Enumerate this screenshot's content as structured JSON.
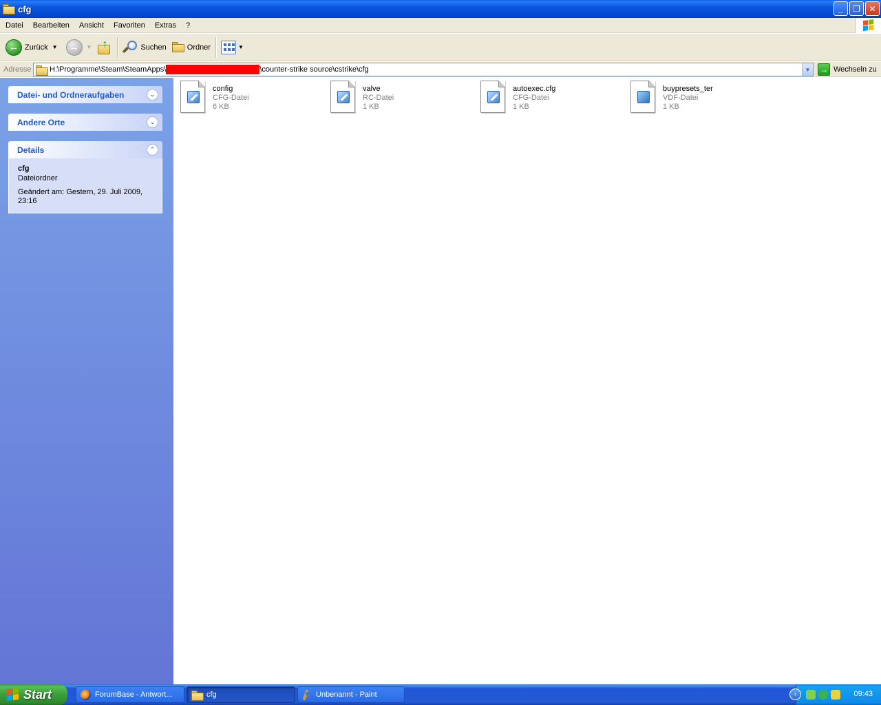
{
  "window": {
    "title": "cfg",
    "controls": {
      "minimize": "_",
      "maximize": "❐",
      "close": "✕"
    }
  },
  "menu": [
    "Datei",
    "Bearbeiten",
    "Ansicht",
    "Favoriten",
    "Extras",
    "?"
  ],
  "toolbar": {
    "back_label": "Zurück",
    "search_label": "Suchen",
    "folders_label": "Ordner"
  },
  "address": {
    "label": "Adresse",
    "path_prefix": "H:\\Programme\\Steam\\SteamApps\\",
    "path_suffix": "\\counter-strike source\\cstrike\\cfg",
    "go_label": "Wechseln zu"
  },
  "taskpane": {
    "panels": [
      {
        "title": "Datei- und Ordneraufgaben",
        "state": "collapsed"
      },
      {
        "title": "Andere Orte",
        "state": "collapsed"
      },
      {
        "title": "Details",
        "state": "expanded"
      }
    ],
    "details": {
      "name": "cfg",
      "type": "Dateiordner",
      "modified": "Geändert am: Gestern, 29. Juli 2009, 23:16"
    }
  },
  "files": [
    {
      "name": "config",
      "type": "CFG-Datei",
      "size": "6 KB",
      "icon": "text-document-icon"
    },
    {
      "name": "valve",
      "type": "RC-Datei",
      "size": "1 KB",
      "icon": "text-document-icon"
    },
    {
      "name": "autoexec.cfg",
      "type": "CFG-Datei",
      "size": "1 KB",
      "icon": "text-document-icon"
    },
    {
      "name": "buypresets_ter",
      "type": "VDF-Datei",
      "size": "1 KB",
      "icon": "system-file-icon"
    }
  ],
  "taskbar": {
    "start_label": "Start",
    "tasks": [
      {
        "label": "ForumBase - Antwort...",
        "icon": "firefox-icon",
        "active": false
      },
      {
        "label": "cfg",
        "icon": "folder-icon",
        "active": true
      },
      {
        "label": "Unbenannt - Paint",
        "icon": "paint-icon",
        "active": false
      }
    ],
    "clock": "09:43"
  },
  "colors": {
    "titlebar": "#0a56dc",
    "taskpane_top": "#7ba2e7",
    "taskpane_bottom": "#6375d6",
    "panel_header_text": "#215dc6",
    "start_button": "#3a9e3a",
    "address_redaction": "#ff0000"
  }
}
